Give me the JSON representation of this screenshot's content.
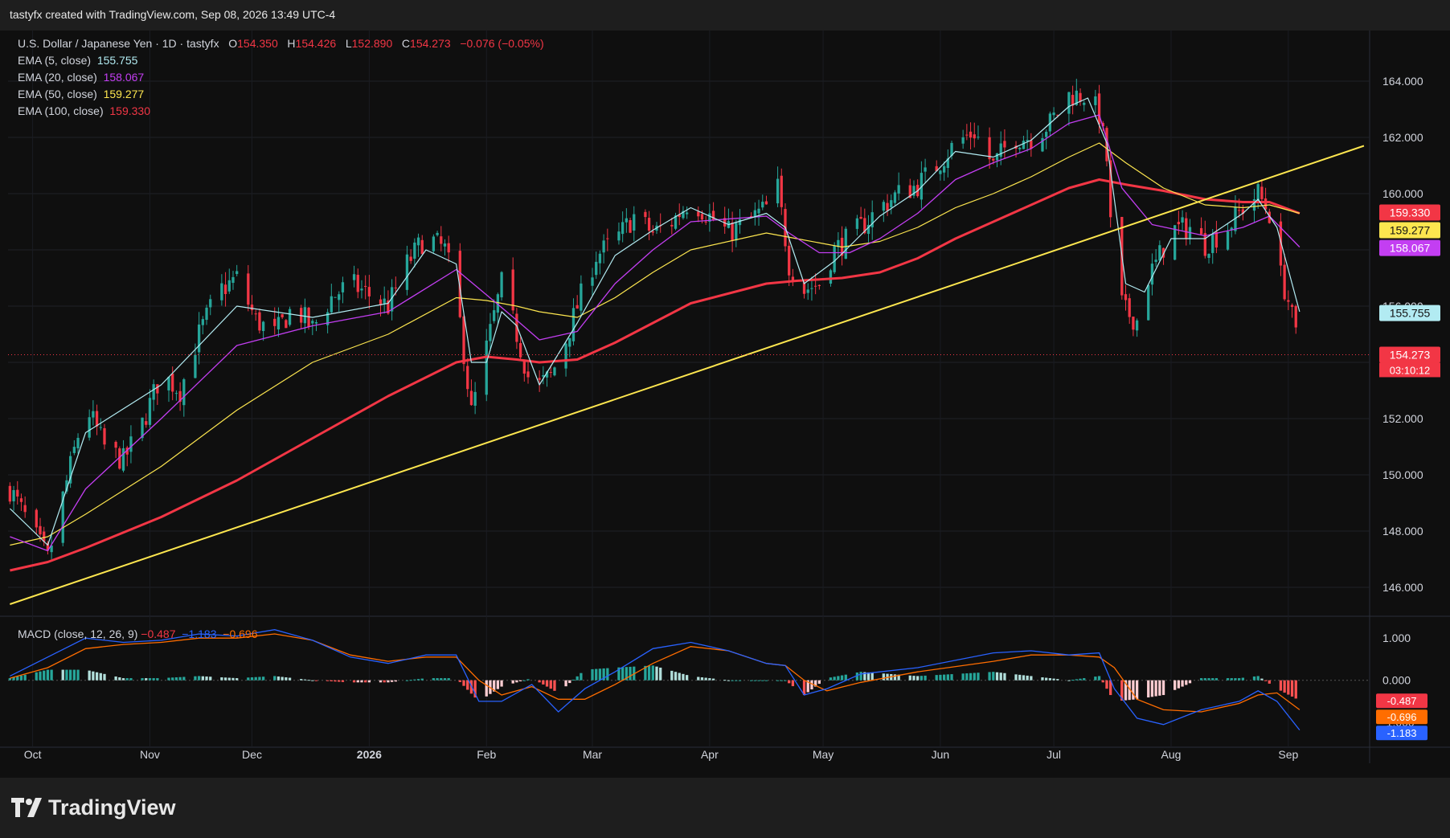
{
  "header": {
    "attribution": "tastyfx created with TradingView.com, Sep 08, 2026 13:49 UTC-4"
  },
  "legend": {
    "symbol": "U.S. Dollar / Japanese Yen · 1D · tastyfx",
    "open_label": "O",
    "open": "154.350",
    "high_label": "H",
    "high": "154.426",
    "low_label": "L",
    "low": "152.890",
    "close_label": "C",
    "close": "154.273",
    "change": "−0.076 (−0.05%)",
    "ema": [
      {
        "label": "EMA (5, close)",
        "value": "155.755",
        "color": "#b2ebf2"
      },
      {
        "label": "EMA (20, close)",
        "value": "158.067",
        "color": "#c33ef2"
      },
      {
        "label": "EMA (50, close)",
        "value": "159.277",
        "color": "#fde64f"
      },
      {
        "label": "EMA (100, close)",
        "value": "159.330",
        "color": "#f23645"
      }
    ]
  },
  "macd_legend": {
    "label": "MACD (close, 12, 26, 9)",
    "hist": "−0.487",
    "macd": "−1.183",
    "signal": "−0.696"
  },
  "price_badges": [
    {
      "value": "159.330",
      "bg": "#f23645",
      "fg": "#ffffff"
    },
    {
      "value": "159.277",
      "bg": "#fde64f",
      "fg": "#131313"
    },
    {
      "value": "158.067",
      "bg": "#c33ef2",
      "fg": "#ffffff"
    },
    {
      "value": "155.755",
      "bg": "#b2ebf2",
      "fg": "#131313"
    },
    {
      "value": "154.273",
      "bg": "#f23645",
      "fg": "#ffffff"
    }
  ],
  "countdown": "03:10:12",
  "macd_badges": [
    {
      "value": "-0.487",
      "bg": "#f23645",
      "fg": "#ffffff"
    },
    {
      "value": "-0.696",
      "bg": "#ff6d00",
      "fg": "#ffffff"
    },
    {
      "value": "-1.183",
      "bg": "#2962ff",
      "fg": "#ffffff"
    }
  ],
  "colors": {
    "up": "#26a69a",
    "down": "#f23645",
    "trendline": "#fde64f",
    "macd_line": "#2962ff",
    "signal_line": "#ff6d00"
  },
  "footer": {
    "brand": "TradingView"
  },
  "chart_data": {
    "type": "candlestick",
    "symbol": "USD/JPY",
    "timeframe": "1D",
    "x_ticks": [
      "Oct",
      "Nov",
      "Dec",
      "2026",
      "Feb",
      "Mar",
      "Apr",
      "May",
      "Jun",
      "Jul",
      "Aug",
      "Sep"
    ],
    "y_ticks": [
      "146.000",
      "148.000",
      "150.000",
      "152.000",
      "154.000",
      "156.000",
      "158.000",
      "160.000",
      "162.000",
      "164.000"
    ],
    "ylim": [
      145.0,
      165.8
    ],
    "close_path": [
      [
        0,
        149.5
      ],
      [
        10,
        147.0
      ],
      [
        20,
        152.5
      ],
      [
        25,
        151.0
      ],
      [
        30,
        150.5
      ],
      [
        35,
        151.8
      ],
      [
        40,
        153.6
      ],
      [
        45,
        153.0
      ],
      [
        50,
        155.0
      ],
      [
        55,
        156.5
      ],
      [
        60,
        157.0
      ],
      [
        65,
        155.5
      ],
      [
        70,
        155.0
      ],
      [
        75,
        156.0
      ],
      [
        80,
        155.2
      ],
      [
        85,
        156.3
      ],
      [
        90,
        156.8
      ],
      [
        95,
        156.4
      ],
      [
        100,
        156.0
      ],
      [
        105,
        157.5
      ],
      [
        110,
        158.5
      ],
      [
        115,
        158.0
      ],
      [
        118,
        156.5
      ],
      [
        122,
        152.2
      ],
      [
        126,
        154.5
      ],
      [
        130,
        156.8
      ],
      [
        134,
        155.0
      ],
      [
        138,
        153.0
      ],
      [
        143,
        153.5
      ],
      [
        147,
        154.8
      ],
      [
        150,
        156.0
      ],
      [
        155,
        157.8
      ],
      [
        160,
        158.3
      ],
      [
        165,
        159.2
      ],
      [
        170,
        158.6
      ],
      [
        175,
        159.0
      ],
      [
        180,
        159.8
      ],
      [
        185,
        159.2
      ],
      [
        190,
        158.6
      ],
      [
        195,
        159.0
      ],
      [
        200,
        159.5
      ],
      [
        203,
        160.2
      ],
      [
        206,
        157.5
      ],
      [
        210,
        156.6
      ],
      [
        214,
        156.8
      ],
      [
        218,
        158.0
      ],
      [
        225,
        158.8
      ],
      [
        230,
        159.5
      ],
      [
        235,
        160.0
      ],
      [
        240,
        160.3
      ],
      [
        245,
        161.0
      ],
      [
        250,
        161.8
      ],
      [
        255,
        162.2
      ],
      [
        260,
        161.0
      ],
      [
        265,
        162.0
      ],
      [
        270,
        162.0
      ],
      [
        275,
        162.5
      ],
      [
        280,
        163.5
      ],
      [
        285,
        163.5
      ],
      [
        288,
        162.8
      ],
      [
        290,
        161.2
      ],
      [
        292,
        156.6
      ],
      [
        295,
        155.8
      ],
      [
        298,
        155.5
      ],
      [
        300,
        156.8
      ],
      [
        303,
        157.5
      ],
      [
        307,
        158.7
      ],
      [
        312,
        158.8
      ],
      [
        316,
        158.2
      ],
      [
        322,
        158.8
      ],
      [
        326,
        159.5
      ],
      [
        330,
        160.0
      ],
      [
        333,
        159.3
      ],
      [
        335,
        157.5
      ],
      [
        338,
        156.2
      ],
      [
        341,
        154.3
      ]
    ],
    "ema": {
      "ema5": [
        [
          0,
          148.8
        ],
        [
          10,
          147.5
        ],
        [
          20,
          151.5
        ],
        [
          40,
          153.2
        ],
        [
          60,
          156.0
        ],
        [
          80,
          155.6
        ],
        [
          100,
          156.1
        ],
        [
          110,
          158.0
        ],
        [
          118,
          157.5
        ],
        [
          122,
          154.0
        ],
        [
          126,
          154.0
        ],
        [
          130,
          155.8
        ],
        [
          134,
          155.3
        ],
        [
          140,
          153.2
        ],
        [
          150,
          155.4
        ],
        [
          160,
          157.8
        ],
        [
          170,
          158.7
        ],
        [
          180,
          159.5
        ],
        [
          190,
          158.9
        ],
        [
          200,
          159.3
        ],
        [
          205,
          158.8
        ],
        [
          210,
          156.8
        ],
        [
          218,
          157.6
        ],
        [
          230,
          159.2
        ],
        [
          240,
          160.1
        ],
        [
          250,
          161.5
        ],
        [
          260,
          161.3
        ],
        [
          270,
          161.9
        ],
        [
          280,
          163.1
        ],
        [
          285,
          163.4
        ],
        [
          290,
          161.8
        ],
        [
          295,
          156.8
        ],
        [
          300,
          156.5
        ],
        [
          307,
          158.4
        ],
        [
          316,
          158.4
        ],
        [
          326,
          159.3
        ],
        [
          330,
          159.8
        ],
        [
          335,
          158.8
        ],
        [
          341,
          155.8
        ]
      ],
      "ema20": [
        [
          0,
          147.8
        ],
        [
          10,
          147.3
        ],
        [
          20,
          149.5
        ],
        [
          40,
          152.0
        ],
        [
          60,
          154.6
        ],
        [
          80,
          155.3
        ],
        [
          100,
          155.8
        ],
        [
          118,
          157.3
        ],
        [
          126,
          156.4
        ],
        [
          134,
          155.5
        ],
        [
          140,
          154.8
        ],
        [
          150,
          155.1
        ],
        [
          160,
          156.8
        ],
        [
          170,
          158.0
        ],
        [
          180,
          159.0
        ],
        [
          200,
          159.2
        ],
        [
          206,
          158.6
        ],
        [
          214,
          157.9
        ],
        [
          222,
          157.9
        ],
        [
          230,
          158.4
        ],
        [
          240,
          159.3
        ],
        [
          250,
          160.5
        ],
        [
          260,
          161.1
        ],
        [
          270,
          161.6
        ],
        [
          280,
          162.5
        ],
        [
          288,
          162.8
        ],
        [
          294,
          160.2
        ],
        [
          302,
          158.9
        ],
        [
          316,
          158.5
        ],
        [
          326,
          158.8
        ],
        [
          333,
          159.2
        ],
        [
          341,
          158.1
        ]
      ],
      "ema50": [
        [
          0,
          147.5
        ],
        [
          10,
          147.8
        ],
        [
          20,
          148.6
        ],
        [
          40,
          150.3
        ],
        [
          60,
          152.3
        ],
        [
          80,
          154.0
        ],
        [
          100,
          155.0
        ],
        [
          118,
          156.3
        ],
        [
          126,
          156.2
        ],
        [
          134,
          156.0
        ],
        [
          140,
          155.8
        ],
        [
          150,
          155.6
        ],
        [
          160,
          156.3
        ],
        [
          170,
          157.2
        ],
        [
          180,
          158.0
        ],
        [
          200,
          158.6
        ],
        [
          208,
          158.4
        ],
        [
          220,
          158.1
        ],
        [
          230,
          158.3
        ],
        [
          240,
          158.8
        ],
        [
          250,
          159.5
        ],
        [
          260,
          160.0
        ],
        [
          270,
          160.6
        ],
        [
          280,
          161.3
        ],
        [
          288,
          161.8
        ],
        [
          295,
          161.1
        ],
        [
          305,
          160.2
        ],
        [
          316,
          159.6
        ],
        [
          326,
          159.5
        ],
        [
          333,
          159.6
        ],
        [
          341,
          159.3
        ]
      ],
      "ema100": [
        [
          0,
          146.6
        ],
        [
          10,
          146.9
        ],
        [
          20,
          147.4
        ],
        [
          40,
          148.5
        ],
        [
          60,
          149.8
        ],
        [
          80,
          151.3
        ],
        [
          100,
          152.8
        ],
        [
          118,
          154.0
        ],
        [
          126,
          154.2
        ],
        [
          134,
          154.1
        ],
        [
          140,
          154.0
        ],
        [
          150,
          154.1
        ],
        [
          160,
          154.7
        ],
        [
          170,
          155.4
        ],
        [
          180,
          156.1
        ],
        [
          200,
          156.8
        ],
        [
          208,
          156.9
        ],
        [
          220,
          157.0
        ],
        [
          230,
          157.2
        ],
        [
          240,
          157.7
        ],
        [
          250,
          158.4
        ],
        [
          260,
          159.0
        ],
        [
          270,
          159.6
        ],
        [
          280,
          160.2
        ],
        [
          288,
          160.5
        ],
        [
          296,
          160.3
        ],
        [
          305,
          160.1
        ],
        [
          316,
          159.8
        ],
        [
          326,
          159.7
        ],
        [
          333,
          159.7
        ],
        [
          341,
          159.3
        ]
      ]
    },
    "trendline": {
      "start": [
        0,
        145.4
      ],
      "end": [
        358,
        161.7
      ]
    },
    "macd": {
      "ylim": [
        -1.55,
        1.5
      ],
      "y_ticks": [
        "-1.000",
        "0.000",
        "1.000"
      ],
      "macd_line": [
        [
          0,
          0.1
        ],
        [
          10,
          0.55
        ],
        [
          20,
          1.0
        ],
        [
          30,
          0.9
        ],
        [
          40,
          0.95
        ],
        [
          50,
          1.1
        ],
        [
          60,
          1.05
        ],
        [
          70,
          1.2
        ],
        [
          80,
          0.95
        ],
        [
          90,
          0.55
        ],
        [
          100,
          0.4
        ],
        [
          110,
          0.6
        ],
        [
          118,
          0.6
        ],
        [
          124,
          -0.5
        ],
        [
          130,
          -0.5
        ],
        [
          138,
          -0.1
        ],
        [
          145,
          -0.75
        ],
        [
          152,
          -0.2
        ],
        [
          160,
          0.2
        ],
        [
          170,
          0.75
        ],
        [
          180,
          0.9
        ],
        [
          190,
          0.7
        ],
        [
          200,
          0.4
        ],
        [
          205,
          0.35
        ],
        [
          210,
          -0.35
        ],
        [
          216,
          -0.2
        ],
        [
          225,
          0.15
        ],
        [
          240,
          0.3
        ],
        [
          260,
          0.65
        ],
        [
          270,
          0.7
        ],
        [
          280,
          0.6
        ],
        [
          288,
          0.65
        ],
        [
          292,
          -0.2
        ],
        [
          298,
          -0.9
        ],
        [
          305,
          -1.05
        ],
        [
          315,
          -0.7
        ],
        [
          325,
          -0.5
        ],
        [
          330,
          -0.25
        ],
        [
          335,
          -0.5
        ],
        [
          341,
          -1.18
        ]
      ],
      "signal_line": [
        [
          0,
          0.05
        ],
        [
          10,
          0.3
        ],
        [
          20,
          0.75
        ],
        [
          30,
          0.85
        ],
        [
          40,
          0.9
        ],
        [
          50,
          1.0
        ],
        [
          60,
          1.0
        ],
        [
          70,
          1.1
        ],
        [
          80,
          0.95
        ],
        [
          90,
          0.6
        ],
        [
          100,
          0.45
        ],
        [
          110,
          0.55
        ],
        [
          118,
          0.55
        ],
        [
          124,
          0.0
        ],
        [
          130,
          -0.35
        ],
        [
          138,
          -0.15
        ],
        [
          145,
          -0.45
        ],
        [
          152,
          -0.45
        ],
        [
          160,
          -0.1
        ],
        [
          170,
          0.4
        ],
        [
          180,
          0.8
        ],
        [
          190,
          0.7
        ],
        [
          200,
          0.4
        ],
        [
          205,
          0.35
        ],
        [
          210,
          0.0
        ],
        [
          216,
          -0.25
        ],
        [
          225,
          -0.05
        ],
        [
          240,
          0.2
        ],
        [
          260,
          0.45
        ],
        [
          270,
          0.6
        ],
        [
          280,
          0.6
        ],
        [
          288,
          0.55
        ],
        [
          292,
          0.3
        ],
        [
          298,
          -0.45
        ],
        [
          305,
          -0.7
        ],
        [
          315,
          -0.75
        ],
        [
          325,
          -0.55
        ],
        [
          330,
          -0.35
        ],
        [
          335,
          -0.3
        ],
        [
          341,
          -0.7
        ]
      ]
    },
    "x_tick_days": [
      6,
      37,
      64,
      95,
      126,
      154,
      185,
      215,
      246,
      276,
      307,
      338
    ]
  }
}
